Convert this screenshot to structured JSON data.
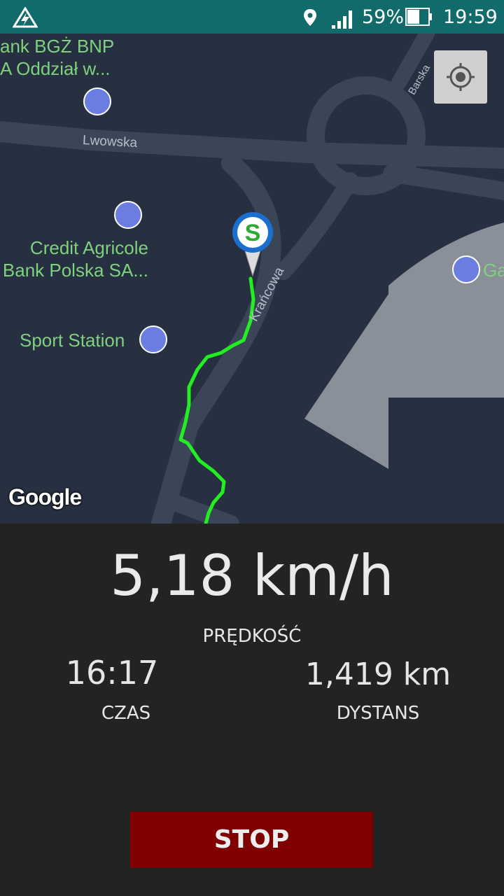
{
  "status_bar": {
    "battery_percent": "59%",
    "time": "19:59",
    "icons": [
      "app-icon",
      "location-icon",
      "signal-icon",
      "battery-icon"
    ]
  },
  "map": {
    "pois": [
      {
        "label": "ank BGŻ BNP\nA Oddział w...",
        "icon": "atm-icon"
      },
      {
        "label": "Credit Agricole\nBank Polska SA...",
        "icon": "atm-icon"
      },
      {
        "label": "Sport Station",
        "icon": "shopping-bag-icon"
      },
      {
        "label": "Ga",
        "icon": "shopping-bag-icon"
      }
    ],
    "streets": [
      "Lwowska",
      "Krańcowa",
      "Barska"
    ],
    "attribution": "Google",
    "route_color": "#22ee22",
    "start_marker_letter": "S"
  },
  "stats": {
    "speed_value": "5,18 km/h",
    "speed_label": "PRĘDKOŚĆ",
    "time_value": "16:17",
    "time_label": "CZAS",
    "distance_value": "1,419 km",
    "distance_label": "DYSTANS"
  },
  "actions": {
    "stop_label": "STOP"
  }
}
